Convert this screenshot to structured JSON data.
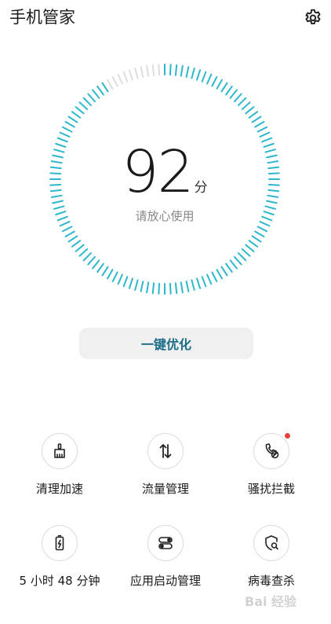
{
  "header": {
    "title": "手机管家",
    "settings_icon": "gear-icon"
  },
  "score": {
    "value": "92",
    "unit": "分",
    "status": "请放心使用",
    "fraction": 0.92
  },
  "colors": {
    "accent": "#2db7cc",
    "track": "#dddddd",
    "button_text": "#1c6d88"
  },
  "optimize_button": {
    "label": "一键优化"
  },
  "tools": [
    {
      "label": "清理加速",
      "icon": "broom-icon"
    },
    {
      "label": "流量管理",
      "icon": "data-arrows-icon"
    },
    {
      "label": "骚扰拦截",
      "icon": "phone-block-icon",
      "badge": true
    },
    {
      "label": "5 小时 48 分钟",
      "icon": "battery-icon"
    },
    {
      "label": "应用启动管理",
      "icon": "toggle-switch-icon"
    },
    {
      "label": "病毒查杀",
      "icon": "shield-search-icon"
    }
  ],
  "watermark": "Bai 经验"
}
